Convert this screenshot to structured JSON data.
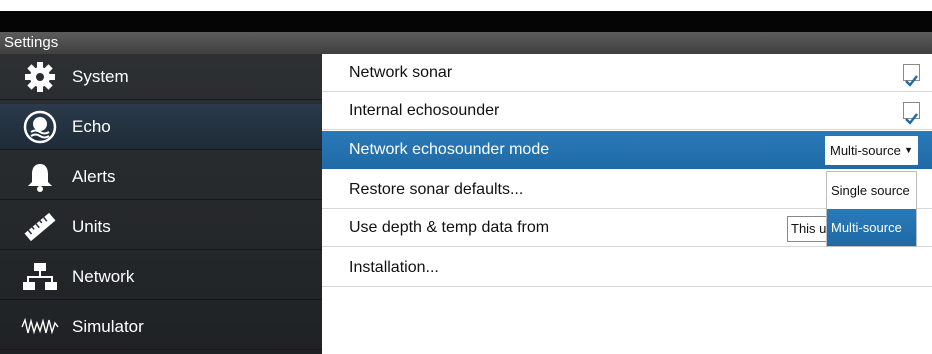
{
  "window": {
    "title": "Settings"
  },
  "sidebar": {
    "items": [
      {
        "label": "System",
        "icon": "gear-icon"
      },
      {
        "label": "Echo",
        "icon": "echo-icon",
        "selected": true
      },
      {
        "label": "Alerts",
        "icon": "bell-icon"
      },
      {
        "label": "Units",
        "icon": "ruler-icon"
      },
      {
        "label": "Network",
        "icon": "network-icon"
      },
      {
        "label": "Simulator",
        "icon": "simulator-icon"
      }
    ]
  },
  "main": {
    "rows": [
      {
        "label": "Network sonar",
        "checked": true
      },
      {
        "label": "Internal echosounder",
        "checked": true
      },
      {
        "label": "Network echosounder mode",
        "value": "Multi-source"
      },
      {
        "label": "Restore sonar defaults..."
      },
      {
        "label": "Use depth & temp data from",
        "value": "This un"
      },
      {
        "label": "Installation..."
      }
    ]
  },
  "dropdown_menu": {
    "options": [
      "Single source",
      "Multi-source"
    ],
    "selected": "Multi-source"
  },
  "colors": {
    "highlight": "#1f6aa6",
    "sidebar_bg": "#2a2d30",
    "checkmark": "#1f6aa6"
  }
}
